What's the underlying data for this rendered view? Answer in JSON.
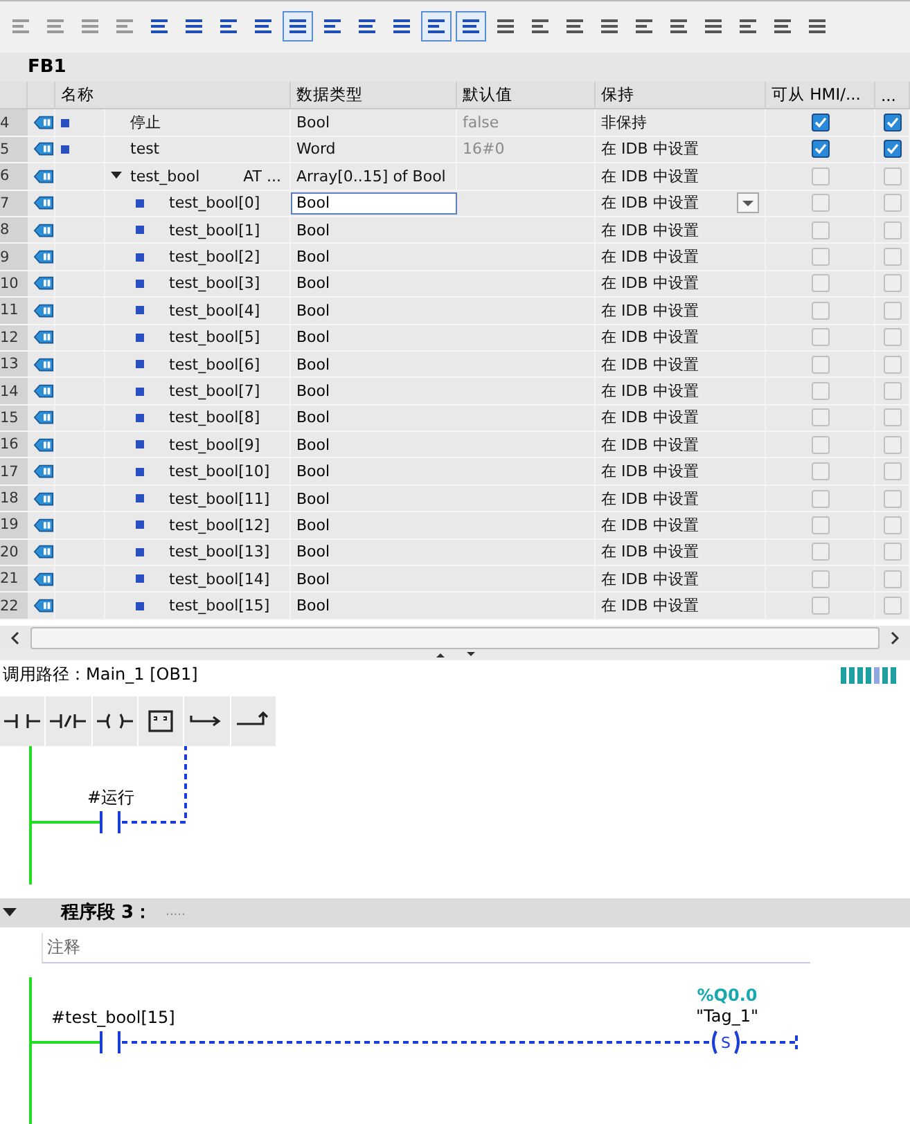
{
  "toolbar": [
    {
      "selected": false
    },
    {
      "selected": false
    },
    {
      "selected": false
    },
    {
      "selected": false
    },
    {
      "selected": false
    },
    {
      "selected": false
    },
    {
      "selected": false
    },
    {
      "selected": false
    },
    {
      "selected": true
    },
    {
      "selected": false
    },
    {
      "selected": false
    },
    {
      "selected": false
    },
    {
      "selected": true
    },
    {
      "selected": true
    },
    {
      "selected": false
    },
    {
      "selected": false
    },
    {
      "selected": false
    },
    {
      "selected": false
    },
    {
      "selected": false
    },
    {
      "selected": false
    },
    {
      "selected": false
    },
    {
      "selected": false
    },
    {
      "selected": false
    },
    {
      "selected": false
    }
  ],
  "block_title": "FB1",
  "columns": [
    "名称",
    "数据类型",
    "默认值",
    "保持",
    "可从 HMI/...",
    "..."
  ],
  "rows": [
    {
      "number": "4",
      "name": "停止",
      "type": "Bool",
      "default": "false",
      "retain": "非保持",
      "hmi_checked": true,
      "col7_checked": true
    },
    {
      "number": "5",
      "name": "test",
      "type": "Word",
      "default": "16#0",
      "retain": "在 IDB 中设置",
      "hmi_checked": true,
      "col7_checked": true
    },
    {
      "number": "6",
      "name": "test_bool",
      "at": "AT ...",
      "type": "Array[0..15] of Bool",
      "retain": "在 IDB 中设置",
      "hmi_checked": false,
      "col7_checked": false,
      "expanded": true,
      "children": [
        {
          "number": "7",
          "name": "test_bool[0]",
          "type": "Bool",
          "retain": "在 IDB 中设置",
          "selected": true,
          "hmi_checked": false,
          "col7_checked": false
        },
        {
          "number": "8",
          "name": "test_bool[1]",
          "type": "Bool",
          "retain": "在 IDB 中设置",
          "selected": false,
          "hmi_checked": false,
          "col7_checked": false
        },
        {
          "number": "9",
          "name": "test_bool[2]",
          "type": "Bool",
          "retain": "在 IDB 中设置",
          "selected": false,
          "hmi_checked": false,
          "col7_checked": false
        },
        {
          "number": "10",
          "name": "test_bool[3]",
          "type": "Bool",
          "retain": "在 IDB 中设置",
          "selected": false,
          "hmi_checked": false,
          "col7_checked": false
        },
        {
          "number": "11",
          "name": "test_bool[4]",
          "type": "Bool",
          "retain": "在 IDB 中设置",
          "selected": false,
          "hmi_checked": false,
          "col7_checked": false
        },
        {
          "number": "12",
          "name": "test_bool[5]",
          "type": "Bool",
          "retain": "在 IDB 中设置",
          "selected": false,
          "hmi_checked": false,
          "col7_checked": false
        },
        {
          "number": "13",
          "name": "test_bool[6]",
          "type": "Bool",
          "retain": "在 IDB 中设置",
          "selected": false,
          "hmi_checked": false,
          "col7_checked": false
        },
        {
          "number": "14",
          "name": "test_bool[7]",
          "type": "Bool",
          "retain": "在 IDB 中设置",
          "selected": false,
          "hmi_checked": false,
          "col7_checked": false
        },
        {
          "number": "15",
          "name": "test_bool[8]",
          "type": "Bool",
          "retain": "在 IDB 中设置",
          "selected": false,
          "hmi_checked": false,
          "col7_checked": false
        },
        {
          "number": "16",
          "name": "test_bool[9]",
          "type": "Bool",
          "retain": "在 IDB 中设置",
          "selected": false,
          "hmi_checked": false,
          "col7_checked": false
        },
        {
          "number": "17",
          "name": "test_bool[10]",
          "type": "Bool",
          "retain": "在 IDB 中设置",
          "selected": false,
          "hmi_checked": false,
          "col7_checked": false
        },
        {
          "number": "18",
          "name": "test_bool[11]",
          "type": "Bool",
          "retain": "在 IDB 中设置",
          "selected": false,
          "hmi_checked": false,
          "col7_checked": false
        },
        {
          "number": "19",
          "name": "test_bool[12]",
          "type": "Bool",
          "retain": "在 IDB 中设置",
          "selected": false,
          "hmi_checked": false,
          "col7_checked": false
        },
        {
          "number": "20",
          "name": "test_bool[13]",
          "type": "Bool",
          "retain": "在 IDB 中设置",
          "selected": false,
          "hmi_checked": false,
          "col7_checked": false
        },
        {
          "number": "21",
          "name": "test_bool[14]",
          "type": "Bool",
          "retain": "在 IDB 中设置",
          "selected": false,
          "hmi_checked": false,
          "col7_checked": false
        },
        {
          "number": "22",
          "name": "test_bool[15]",
          "type": "Bool",
          "retain": "在 IDB 中设置",
          "selected": false,
          "hmi_checked": false,
          "col7_checked": false
        }
      ]
    }
  ],
  "call_path": {
    "label": "调用路径：",
    "value": "Main_1 [OB1]"
  },
  "lad_palette": [
    {
      "kind": "no"
    },
    {
      "kind": "nc"
    },
    {
      "kind": "coil"
    },
    {
      "kind": "box"
    },
    {
      "kind": "branch_open"
    },
    {
      "kind": "branch_close"
    }
  ],
  "network_2": {
    "contact": "#运行"
  },
  "network_3": {
    "title": "程序段 3：",
    "dots": ".....",
    "comment": "注释",
    "contact": "#test_bool[15]",
    "address": "%Q0.0",
    "tag": "\"Tag_1\"",
    "coil": "S"
  }
}
